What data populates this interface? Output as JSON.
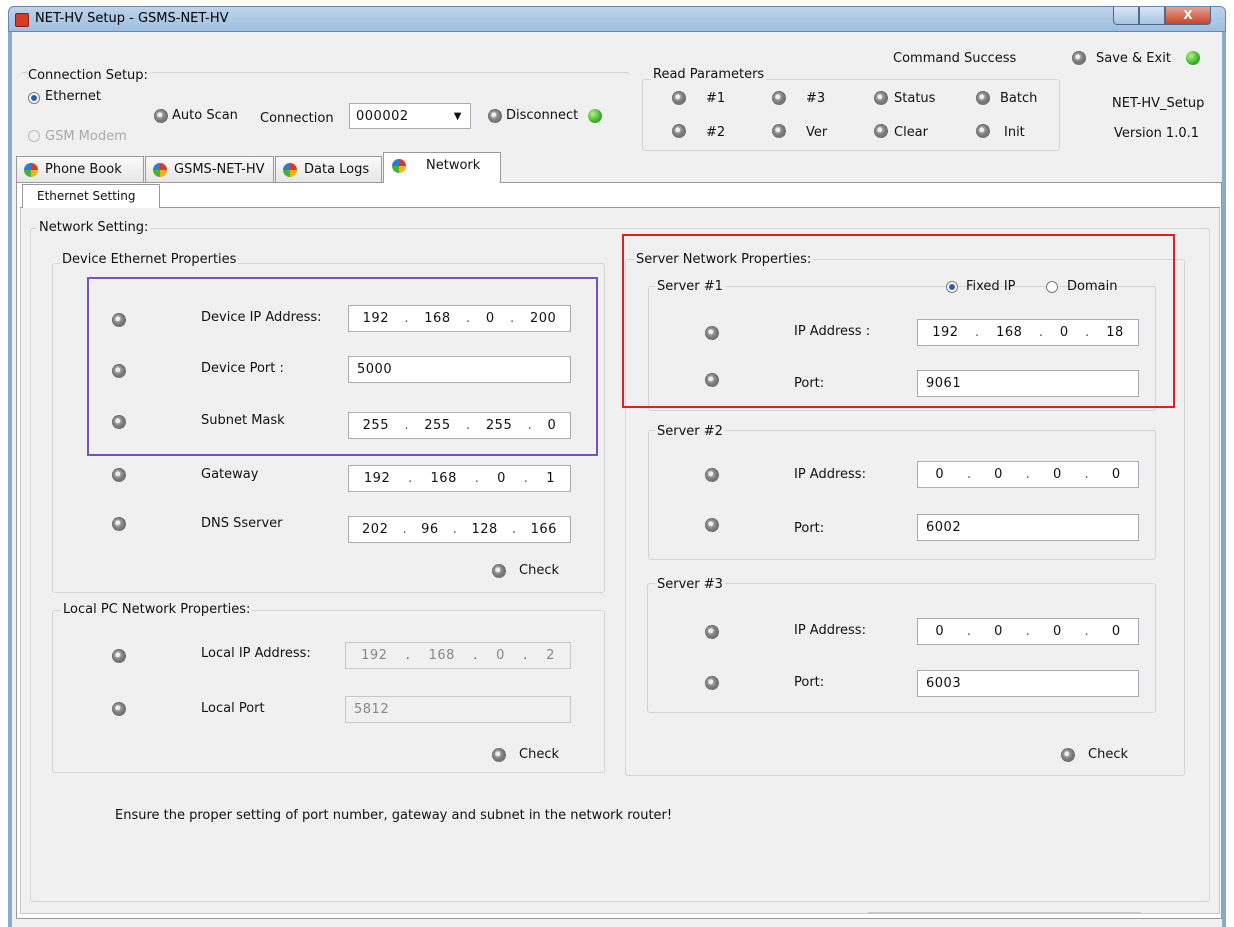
{
  "window": {
    "title": "NET-HV Setup -  GSMS-NET-HV",
    "close": "X"
  },
  "connection": {
    "heading": "Connection Setup:",
    "ethernet": "Ethernet",
    "gsm": "GSM Modem",
    "auto_scan": "Auto Scan",
    "connection_label": "Connection",
    "connection_value": "000002",
    "disconnect": "Disconnect"
  },
  "read": {
    "heading": "Read Parameters",
    "b1": "#1",
    "b2": "#2",
    "b3": "#3",
    "ver": "Ver",
    "status": "Status",
    "clear": "Clear",
    "batch": "Batch",
    "init": "Init"
  },
  "top_right": {
    "command_status": "Command Success",
    "save_exit": "Save & Exit",
    "app_name": "NET-HV_Setup",
    "version": "Version 1.0.1"
  },
  "tabs": [
    "Phone Book",
    "GSMS-NET-HV",
    "Data Logs",
    "Network"
  ],
  "subtab": "Ethernet Setting",
  "network": {
    "heading": "Network Setting:",
    "device": {
      "heading": "Device Ethernet Properties",
      "ip_label": "Device IP Address:",
      "ip": [
        "192",
        "168",
        "0",
        "200"
      ],
      "port_label": "Device Port :",
      "port": "5000",
      "mask_label": "Subnet Mask",
      "mask": [
        "255",
        "255",
        "255",
        "0"
      ],
      "gw_label": "Gateway",
      "gw": [
        "192",
        "168",
        "0",
        "1"
      ],
      "dns_label": "DNS Sserver",
      "dns": [
        "202",
        "96",
        "128",
        "166"
      ],
      "check": "Check"
    },
    "local": {
      "heading": "Local PC Network Properties:",
      "ip_label": "Local IP Address:",
      "ip": [
        "192",
        "168",
        "0",
        "2"
      ],
      "port_label": "Local Port",
      "port": "5812",
      "check": "Check"
    },
    "server": {
      "heading": "Server  Network Properties:",
      "s1": {
        "title": "Server #1",
        "fixed": "Fixed IP",
        "domain": "Domain",
        "ip_label": "IP Address :",
        "ip": [
          "192",
          "168",
          "0",
          "18"
        ],
        "port_label": "Port:",
        "port": "9061"
      },
      "s2": {
        "title": "Server #2",
        "ip_label": "IP Address:",
        "ip": [
          "0",
          "0",
          "0",
          "0"
        ],
        "port_label": "Port:",
        "port": "6002"
      },
      "s3": {
        "title": "Server #3",
        "ip_label": "IP Address:",
        "ip": [
          "0",
          "0",
          "0",
          "0"
        ],
        "port_label": "Port:",
        "port": "6003"
      },
      "check": "Check"
    },
    "note": "Ensure the proper setting of port number, gateway and subnet in the network router!"
  }
}
